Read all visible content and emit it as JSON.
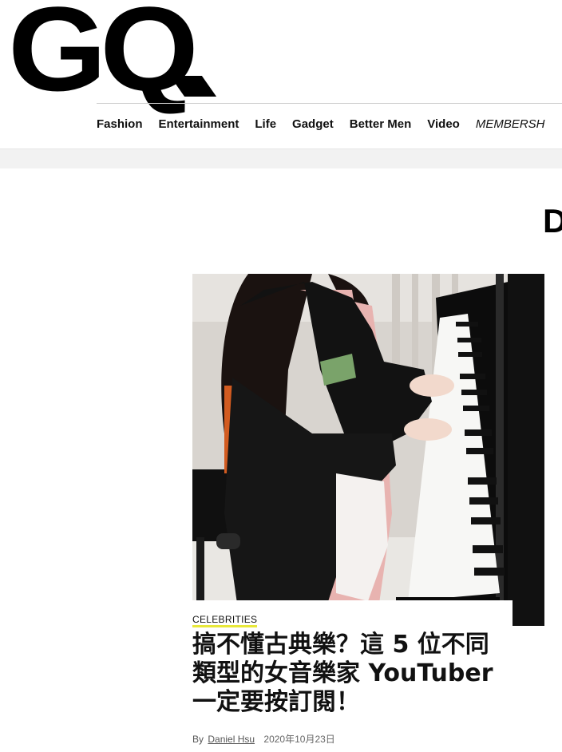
{
  "brand": {
    "logo_text": "GQ"
  },
  "nav": {
    "items": [
      {
        "label": "Fashion"
      },
      {
        "label": "Entertainment"
      },
      {
        "label": "Life"
      },
      {
        "label": "Gadget"
      },
      {
        "label": "Better Men"
      },
      {
        "label": "Video"
      },
      {
        "label": "MEMBERSH"
      }
    ]
  },
  "section": {
    "partial_heading": "D"
  },
  "article": {
    "category": "CELEBRITIES",
    "headline": "搞不懂古典樂？這 5 位不同類型的女音樂家 YouTuber 一定要按訂閱！",
    "by_prefix": "By",
    "author": "Daniel Hsu",
    "date": "2020年10月23日",
    "image_subject": "woman-in-kimono-playing-grand-piano"
  },
  "colors": {
    "category_underline": "#e8e83a",
    "band_gray": "#f2f2f2"
  }
}
